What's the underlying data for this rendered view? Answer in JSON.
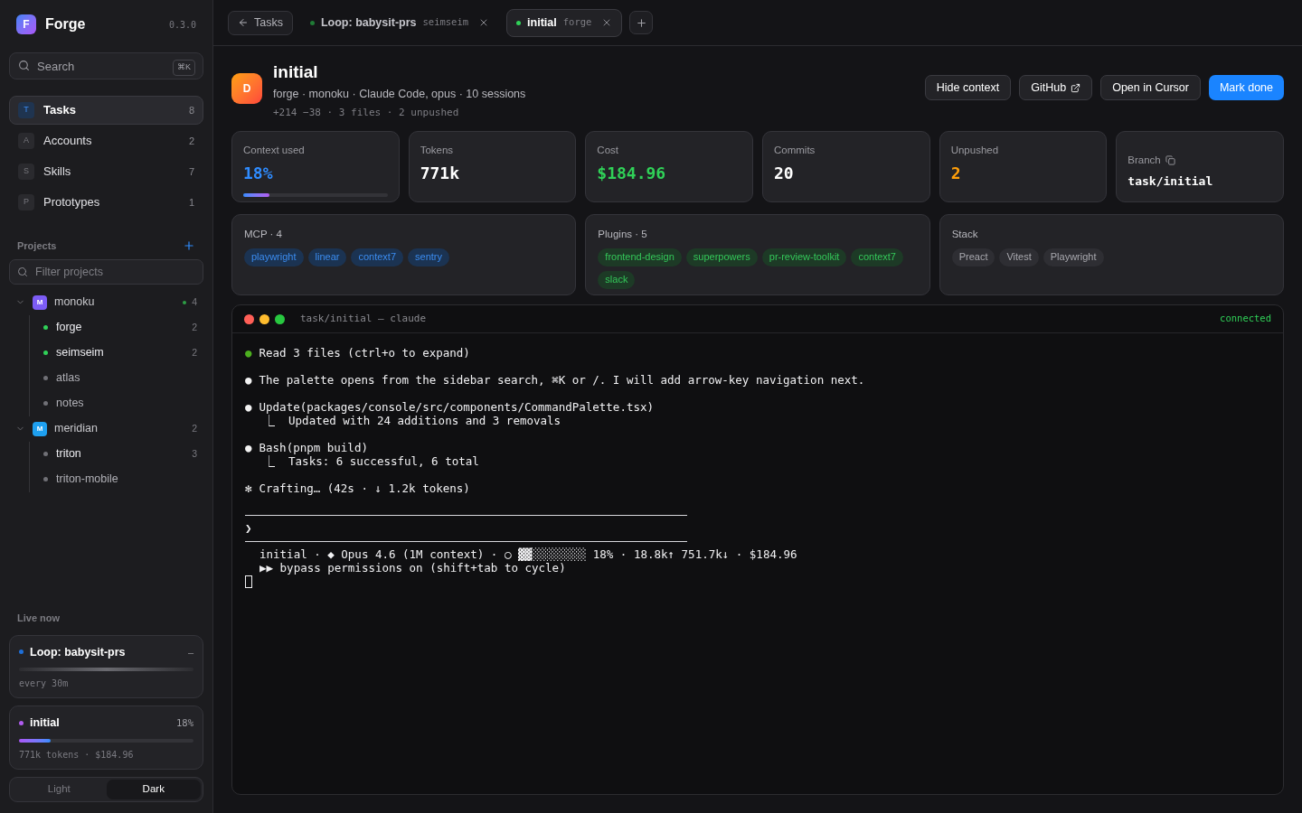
{
  "app": {
    "logo_letter": "F",
    "name": "Forge",
    "version": "0.3.0"
  },
  "search": {
    "placeholder": "Search",
    "shortcut": "⌘K"
  },
  "nav": [
    {
      "letter": "T",
      "label": "Tasks",
      "count": "8",
      "selected": true
    },
    {
      "letter": "A",
      "label": "Accounts",
      "count": "2",
      "selected": false
    },
    {
      "letter": "S",
      "label": "Skills",
      "count": "7",
      "selected": false
    },
    {
      "letter": "P",
      "label": "Prototypes",
      "count": "1",
      "selected": false
    }
  ],
  "projects": {
    "title": "Projects",
    "filter_placeholder": "Filter projects",
    "groups": [
      {
        "letter": "M",
        "name": "monoku",
        "color": "#7c5cf5",
        "live": true,
        "count": "4",
        "expanded": true,
        "children": [
          {
            "name": "forge",
            "count": "2",
            "live": true
          },
          {
            "name": "seimseim",
            "count": "2",
            "live": true
          },
          {
            "name": "atlas",
            "live": false
          },
          {
            "name": "notes",
            "live": false
          }
        ]
      },
      {
        "letter": "M",
        "name": "meridian",
        "color": "#1ea0f0",
        "live": false,
        "count": "2",
        "expanded": true,
        "children": [
          {
            "name": "triton",
            "count": "3",
            "live": false
          },
          {
            "name": "triton-mobile",
            "live": false
          }
        ]
      }
    ]
  },
  "live_now": {
    "title": "Live now",
    "items": [
      {
        "kind": "loop",
        "name": "Loop: babysit-prs",
        "color": "#1e6fd9",
        "action": "–",
        "detail": "every 30m"
      },
      {
        "kind": "progress",
        "name": "initial",
        "color": "#b05cf0",
        "reading": "18%",
        "level": 0.18,
        "detail": "771k tokens · $184.96"
      }
    ]
  },
  "theme": [
    {
      "label": "Light",
      "selected": false
    },
    {
      "label": "Dark",
      "selected": true
    }
  ],
  "tabs": [
    {
      "kind": "back",
      "label": "Tasks"
    },
    {
      "kind": "task",
      "label": "Loop: babysit-prs",
      "sub": "seimseim",
      "selected": false
    },
    {
      "kind": "task",
      "label": "initial",
      "sub": "forge",
      "selected": true
    }
  ],
  "header": {
    "avatar_letter": "D",
    "title": "initial",
    "meta": "forge · monoku · Claude Code, opus · 10 sessions",
    "stats_line": "+214 −38 · 3 files · 2 unpushed",
    "buttons": [
      {
        "kind": "plain",
        "label": "Hide context"
      },
      {
        "kind": "external",
        "label": "GitHub"
      },
      {
        "kind": "plain",
        "label": "Open in Cursor"
      },
      {
        "kind": "primary",
        "label": "Mark done"
      }
    ]
  },
  "stats": [
    {
      "kind": "meter",
      "label": "Context used",
      "value": "18%",
      "color": "#2f8cff",
      "level": 0.18
    },
    {
      "kind": "plain",
      "label": "Tokens",
      "value": "771k",
      "color": "#ffffff"
    },
    {
      "kind": "plain",
      "label": "Cost",
      "value": "$184.96",
      "color": "#30d158"
    },
    {
      "kind": "plain",
      "label": "Commits",
      "value": "20",
      "color": "#ffffff"
    },
    {
      "kind": "plain",
      "label": "Unpushed",
      "value": "2",
      "color": "#ff9f0a"
    },
    {
      "kind": "copy",
      "label": "Branch",
      "value": "task/initial",
      "color": "#ffffff"
    }
  ],
  "chip_cards": [
    {
      "title": "MCP · 4",
      "kind": "blue",
      "chips": [
        "playwright",
        "linear",
        "context7",
        "sentry"
      ]
    },
    {
      "title": "Plugins · 5",
      "kind": "green",
      "chips": [
        "frontend-design",
        "superpowers",
        "pr-review-toolkit",
        "context7",
        "slack"
      ]
    },
    {
      "title": "Stack",
      "kind": "gray",
      "chips": [
        "Preact",
        "Vitest",
        "Playwright"
      ]
    }
  ],
  "terminal": {
    "title": "task/initial — claude",
    "status": "connected",
    "lines": [
      {
        "kind": "entry",
        "bullet": "●",
        "color": "#4caf1f",
        "text": "Read 3 files (ctrl+o to expand)"
      },
      {
        "kind": "gap"
      },
      {
        "kind": "entry",
        "bullet": "●",
        "color": "#f2f2f2",
        "text": "The palette opens from the sidebar search, ⌘K or /. I will add arrow-key navigation next."
      },
      {
        "kind": "gap"
      },
      {
        "kind": "entry",
        "bullet": "●",
        "color": "#f2f2f2",
        "text": "Update(packages/console/src/components/CommandPalette.tsx)"
      },
      {
        "kind": "sub",
        "text": "⎿  Updated with 24 additions and 3 removals"
      },
      {
        "kind": "gap"
      },
      {
        "kind": "entry",
        "bullet": "●",
        "color": "#f2f2f2",
        "text": "Bash(pnpm build)"
      },
      {
        "kind": "sub",
        "text": "⎿  Tasks: 6 successful, 6 total"
      },
      {
        "kind": "gap"
      },
      {
        "kind": "entry",
        "bullet": "✻",
        "color": "#f2f2f2",
        "text": "Crafting… (42s · ↓ 1.2k tokens)"
      },
      {
        "kind": "gap"
      },
      {
        "kind": "rule"
      },
      {
        "kind": "prompt",
        "text": "❯"
      },
      {
        "kind": "rule"
      },
      {
        "kind": "status",
        "text": "initial · ◆ Opus 4.6 (1M context) · ○ ▓▓░░░░░░░░ 18% · 18.8k↑ 751.7k↓ · $184.96"
      },
      {
        "kind": "status",
        "text": "▶▶ bypass permissions on (shift+tab to cycle)"
      },
      {
        "kind": "cursor"
      }
    ]
  }
}
